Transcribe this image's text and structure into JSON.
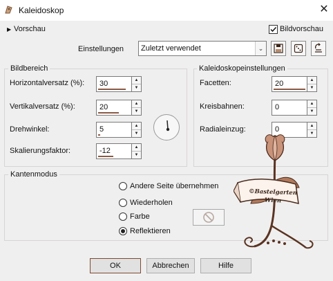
{
  "window": {
    "title": "Kaleidoskop"
  },
  "preview": {
    "toggle_label": "Vorschau",
    "bildvorschau_label": "Bildvorschau",
    "bildvorschau_checked": true
  },
  "settings": {
    "label": "Einstellungen",
    "value": "Zuletzt verwendet"
  },
  "bildbereich": {
    "title": "Bildbereich",
    "horizontal": {
      "label": "Horizontalversatz (%):",
      "value": "30"
    },
    "vertikal": {
      "label": "Vertikalversatz (%):",
      "value": "20"
    },
    "drehwinkel": {
      "label": "Drehwinkel:",
      "value": "5"
    },
    "skalierung": {
      "label": "Skalierungsfaktor:",
      "value": "-12"
    }
  },
  "kaleido": {
    "title": "Kaleidoskopeinstellungen",
    "facetten": {
      "label": "Facetten:",
      "value": "20"
    },
    "kreisbahnen": {
      "label": "Kreisbahnen:",
      "value": "0"
    },
    "radialeinzug": {
      "label": "Radialeinzug:",
      "value": "0"
    }
  },
  "kantenmodus": {
    "title": "Kantenmodus",
    "options": [
      "Andere Seite übernehmen",
      "Wiederholen",
      "Farbe",
      "Reflektieren"
    ],
    "selected": "Reflektieren"
  },
  "watermark": {
    "line1": "©Bastelgarten",
    "line2": "Wien"
  },
  "buttons": {
    "ok": "OK",
    "cancel": "Abbrechen",
    "help": "Hilfe"
  },
  "colors": {
    "accent": "#8b5a44",
    "background": "#f0efef"
  }
}
